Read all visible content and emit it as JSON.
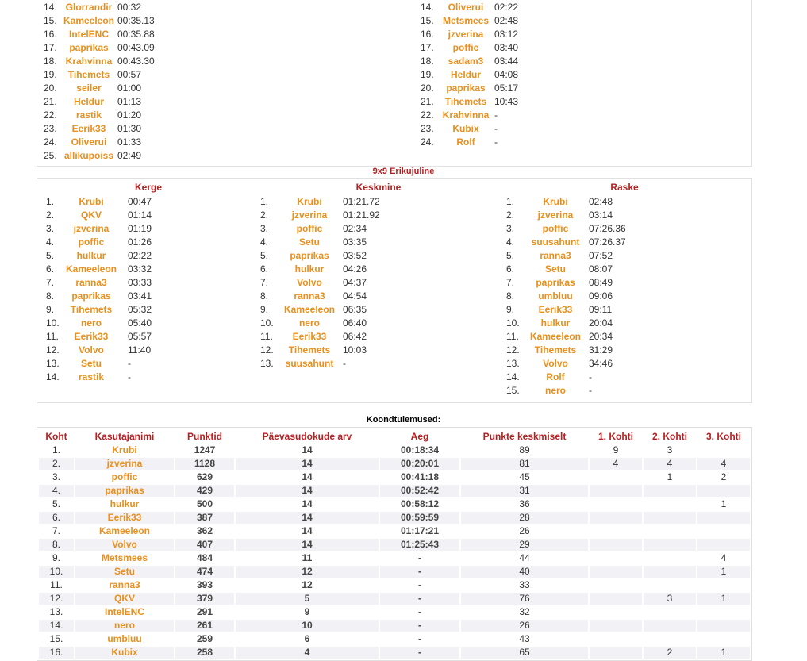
{
  "top_panel": {
    "left": [
      {
        "rank": "14.",
        "name": "Glorrandir",
        "time": "00:32"
      },
      {
        "rank": "15.",
        "name": "Kameeleon",
        "time": "00:35.13"
      },
      {
        "rank": "16.",
        "name": "IntelENC",
        "time": "00:35.88"
      },
      {
        "rank": "17.",
        "name": "paprikas",
        "time": "00:43.09"
      },
      {
        "rank": "18.",
        "name": "Krahvinna",
        "time": "00:43.30"
      },
      {
        "rank": "19.",
        "name": "Tihemets",
        "time": "00:57"
      },
      {
        "rank": "20.",
        "name": "seiler",
        "time": "01:00"
      },
      {
        "rank": "21.",
        "name": "Heldur",
        "time": "01:13"
      },
      {
        "rank": "22.",
        "name": "rastik",
        "time": "01:20"
      },
      {
        "rank": "23.",
        "name": "Eerik33",
        "time": "01:30"
      },
      {
        "rank": "24.",
        "name": "Oliverui",
        "time": "01:33"
      },
      {
        "rank": "25.",
        "name": "allikupoiss",
        "time": "02:49"
      }
    ],
    "right": [
      {
        "rank": "14.",
        "name": "Oliverui",
        "time": "02:22"
      },
      {
        "rank": "15.",
        "name": "Metsmees",
        "time": "02:48"
      },
      {
        "rank": "16.",
        "name": "jzverina",
        "time": "03:12"
      },
      {
        "rank": "17.",
        "name": "poffic",
        "time": "03:40"
      },
      {
        "rank": "18.",
        "name": "sadam3",
        "time": "03:44"
      },
      {
        "rank": "19.",
        "name": "Heldur",
        "time": "04:08"
      },
      {
        "rank": "20.",
        "name": "paprikas",
        "time": "05:17"
      },
      {
        "rank": "21.",
        "name": "Tihemets",
        "time": "10:43"
      },
      {
        "rank": "22.",
        "name": "Krahvinna",
        "time": "-"
      },
      {
        "rank": "23.",
        "name": "Kubix",
        "time": "-"
      },
      {
        "rank": "24.",
        "name": "Rolf",
        "time": "-"
      }
    ]
  },
  "section_title": "9x9 Erikujuline",
  "columns": [
    {
      "heading": "Kerge",
      "rows": [
        {
          "rank": "1.",
          "name": "Krubi",
          "time": "00:47"
        },
        {
          "rank": "2.",
          "name": "QKV",
          "time": "01:14"
        },
        {
          "rank": "3.",
          "name": "jzverina",
          "time": "01:19"
        },
        {
          "rank": "4.",
          "name": "poffic",
          "time": "01:26"
        },
        {
          "rank": "5.",
          "name": "hulkur",
          "time": "02:22"
        },
        {
          "rank": "6.",
          "name": "Kameeleon",
          "time": "03:32"
        },
        {
          "rank": "7.",
          "name": "ranna3",
          "time": "03:33"
        },
        {
          "rank": "8.",
          "name": "paprikas",
          "time": "03:41"
        },
        {
          "rank": "9.",
          "name": "Tihemets",
          "time": "05:32"
        },
        {
          "rank": "10.",
          "name": "nero",
          "time": "05:40"
        },
        {
          "rank": "11.",
          "name": "Eerik33",
          "time": "05:57"
        },
        {
          "rank": "12.",
          "name": "Volvo",
          "time": "11:40"
        },
        {
          "rank": "13.",
          "name": "Setu",
          "time": "-"
        },
        {
          "rank": "14.",
          "name": "rastik",
          "time": "-"
        }
      ]
    },
    {
      "heading": "Keskmine",
      "rows": [
        {
          "rank": "1.",
          "name": "Krubi",
          "time": "01:21.72"
        },
        {
          "rank": "2.",
          "name": "jzverina",
          "time": "01:21.92"
        },
        {
          "rank": "3.",
          "name": "poffic",
          "time": "02:34"
        },
        {
          "rank": "4.",
          "name": "Setu",
          "time": "03:35"
        },
        {
          "rank": "5.",
          "name": "paprikas",
          "time": "03:52"
        },
        {
          "rank": "6.",
          "name": "hulkur",
          "time": "04:26"
        },
        {
          "rank": "7.",
          "name": "Volvo",
          "time": "04:37"
        },
        {
          "rank": "8.",
          "name": "ranna3",
          "time": "04:54"
        },
        {
          "rank": "9.",
          "name": "Kameeleon",
          "time": "06:35"
        },
        {
          "rank": "10.",
          "name": "nero",
          "time": "06:40"
        },
        {
          "rank": "11.",
          "name": "Eerik33",
          "time": "06:42"
        },
        {
          "rank": "12.",
          "name": "Tihemets",
          "time": "10:03"
        },
        {
          "rank": "13.",
          "name": "suusahunt",
          "time": "-"
        }
      ]
    },
    {
      "heading": "Raske",
      "rows": [
        {
          "rank": "1.",
          "name": "Krubi",
          "time": "02:48"
        },
        {
          "rank": "2.",
          "name": "jzverina",
          "time": "03:14"
        },
        {
          "rank": "3.",
          "name": "poffic",
          "time": "07:26.36"
        },
        {
          "rank": "4.",
          "name": "suusahunt",
          "time": "07:26.37"
        },
        {
          "rank": "5.",
          "name": "ranna3",
          "time": "07:52"
        },
        {
          "rank": "6.",
          "name": "Setu",
          "time": "08:07"
        },
        {
          "rank": "7.",
          "name": "paprikas",
          "time": "08:49"
        },
        {
          "rank": "8.",
          "name": "umbluu",
          "time": "09:06"
        },
        {
          "rank": "9.",
          "name": "Eerik33",
          "time": "09:11"
        },
        {
          "rank": "10.",
          "name": "hulkur",
          "time": "20:04"
        },
        {
          "rank": "11.",
          "name": "Kameeleon",
          "time": "20:34"
        },
        {
          "rank": "12.",
          "name": "Tihemets",
          "time": "31:29"
        },
        {
          "rank": "13.",
          "name": "Volvo",
          "time": "34:46"
        },
        {
          "rank": "14.",
          "name": "Rolf",
          "time": "-"
        },
        {
          "rank": "15.",
          "name": "nero",
          "time": "-"
        }
      ]
    }
  ],
  "summary": {
    "title": "Koondtulemused:",
    "headers": [
      "Koht",
      "Kasutajanimi",
      "Punktid",
      "Päevasudokude arv",
      "Aeg",
      "Punkte keskmiselt",
      "1. Kohti",
      "2. Kohti",
      "3. Kohti"
    ],
    "rows": [
      [
        "1.",
        "Krubi",
        "1247",
        "14",
        "00:18:34",
        "89",
        "9",
        "3",
        ""
      ],
      [
        "2.",
        "jzverina",
        "1128",
        "14",
        "00:20:01",
        "81",
        "4",
        "4",
        "4"
      ],
      [
        "3.",
        "poffic",
        "629",
        "14",
        "00:41:18",
        "45",
        "",
        "1",
        "2"
      ],
      [
        "4.",
        "paprikas",
        "429",
        "14",
        "00:52:42",
        "31",
        "",
        "",
        ""
      ],
      [
        "5.",
        "hulkur",
        "500",
        "14",
        "00:58:12",
        "36",
        "",
        "",
        "1"
      ],
      [
        "6.",
        "Eerik33",
        "387",
        "14",
        "00:59:59",
        "28",
        "",
        "",
        ""
      ],
      [
        "7.",
        "Kameeleon",
        "362",
        "14",
        "01:17:21",
        "26",
        "",
        "",
        ""
      ],
      [
        "8.",
        "Volvo",
        "407",
        "14",
        "01:25:43",
        "29",
        "",
        "",
        ""
      ],
      [
        "9.",
        "Metsmees",
        "484",
        "11",
        "-",
        "44",
        "",
        "",
        "4"
      ],
      [
        "10.",
        "Setu",
        "474",
        "12",
        "-",
        "40",
        "",
        "",
        "1"
      ],
      [
        "11.",
        "ranna3",
        "393",
        "12",
        "-",
        "33",
        "",
        "",
        ""
      ],
      [
        "12.",
        "QKV",
        "379",
        "5",
        "-",
        "76",
        "",
        "3",
        "1"
      ],
      [
        "13.",
        "IntelENC",
        "291",
        "9",
        "-",
        "32",
        "",
        "",
        ""
      ],
      [
        "14.",
        "nero",
        "261",
        "10",
        "-",
        "26",
        "",
        "",
        ""
      ],
      [
        "15.",
        "umbluu",
        "259",
        "6",
        "-",
        "43",
        "",
        "",
        ""
      ],
      [
        "16.",
        "Kubix",
        "258",
        "4",
        "-",
        "65",
        "",
        "2",
        "1"
      ]
    ]
  }
}
